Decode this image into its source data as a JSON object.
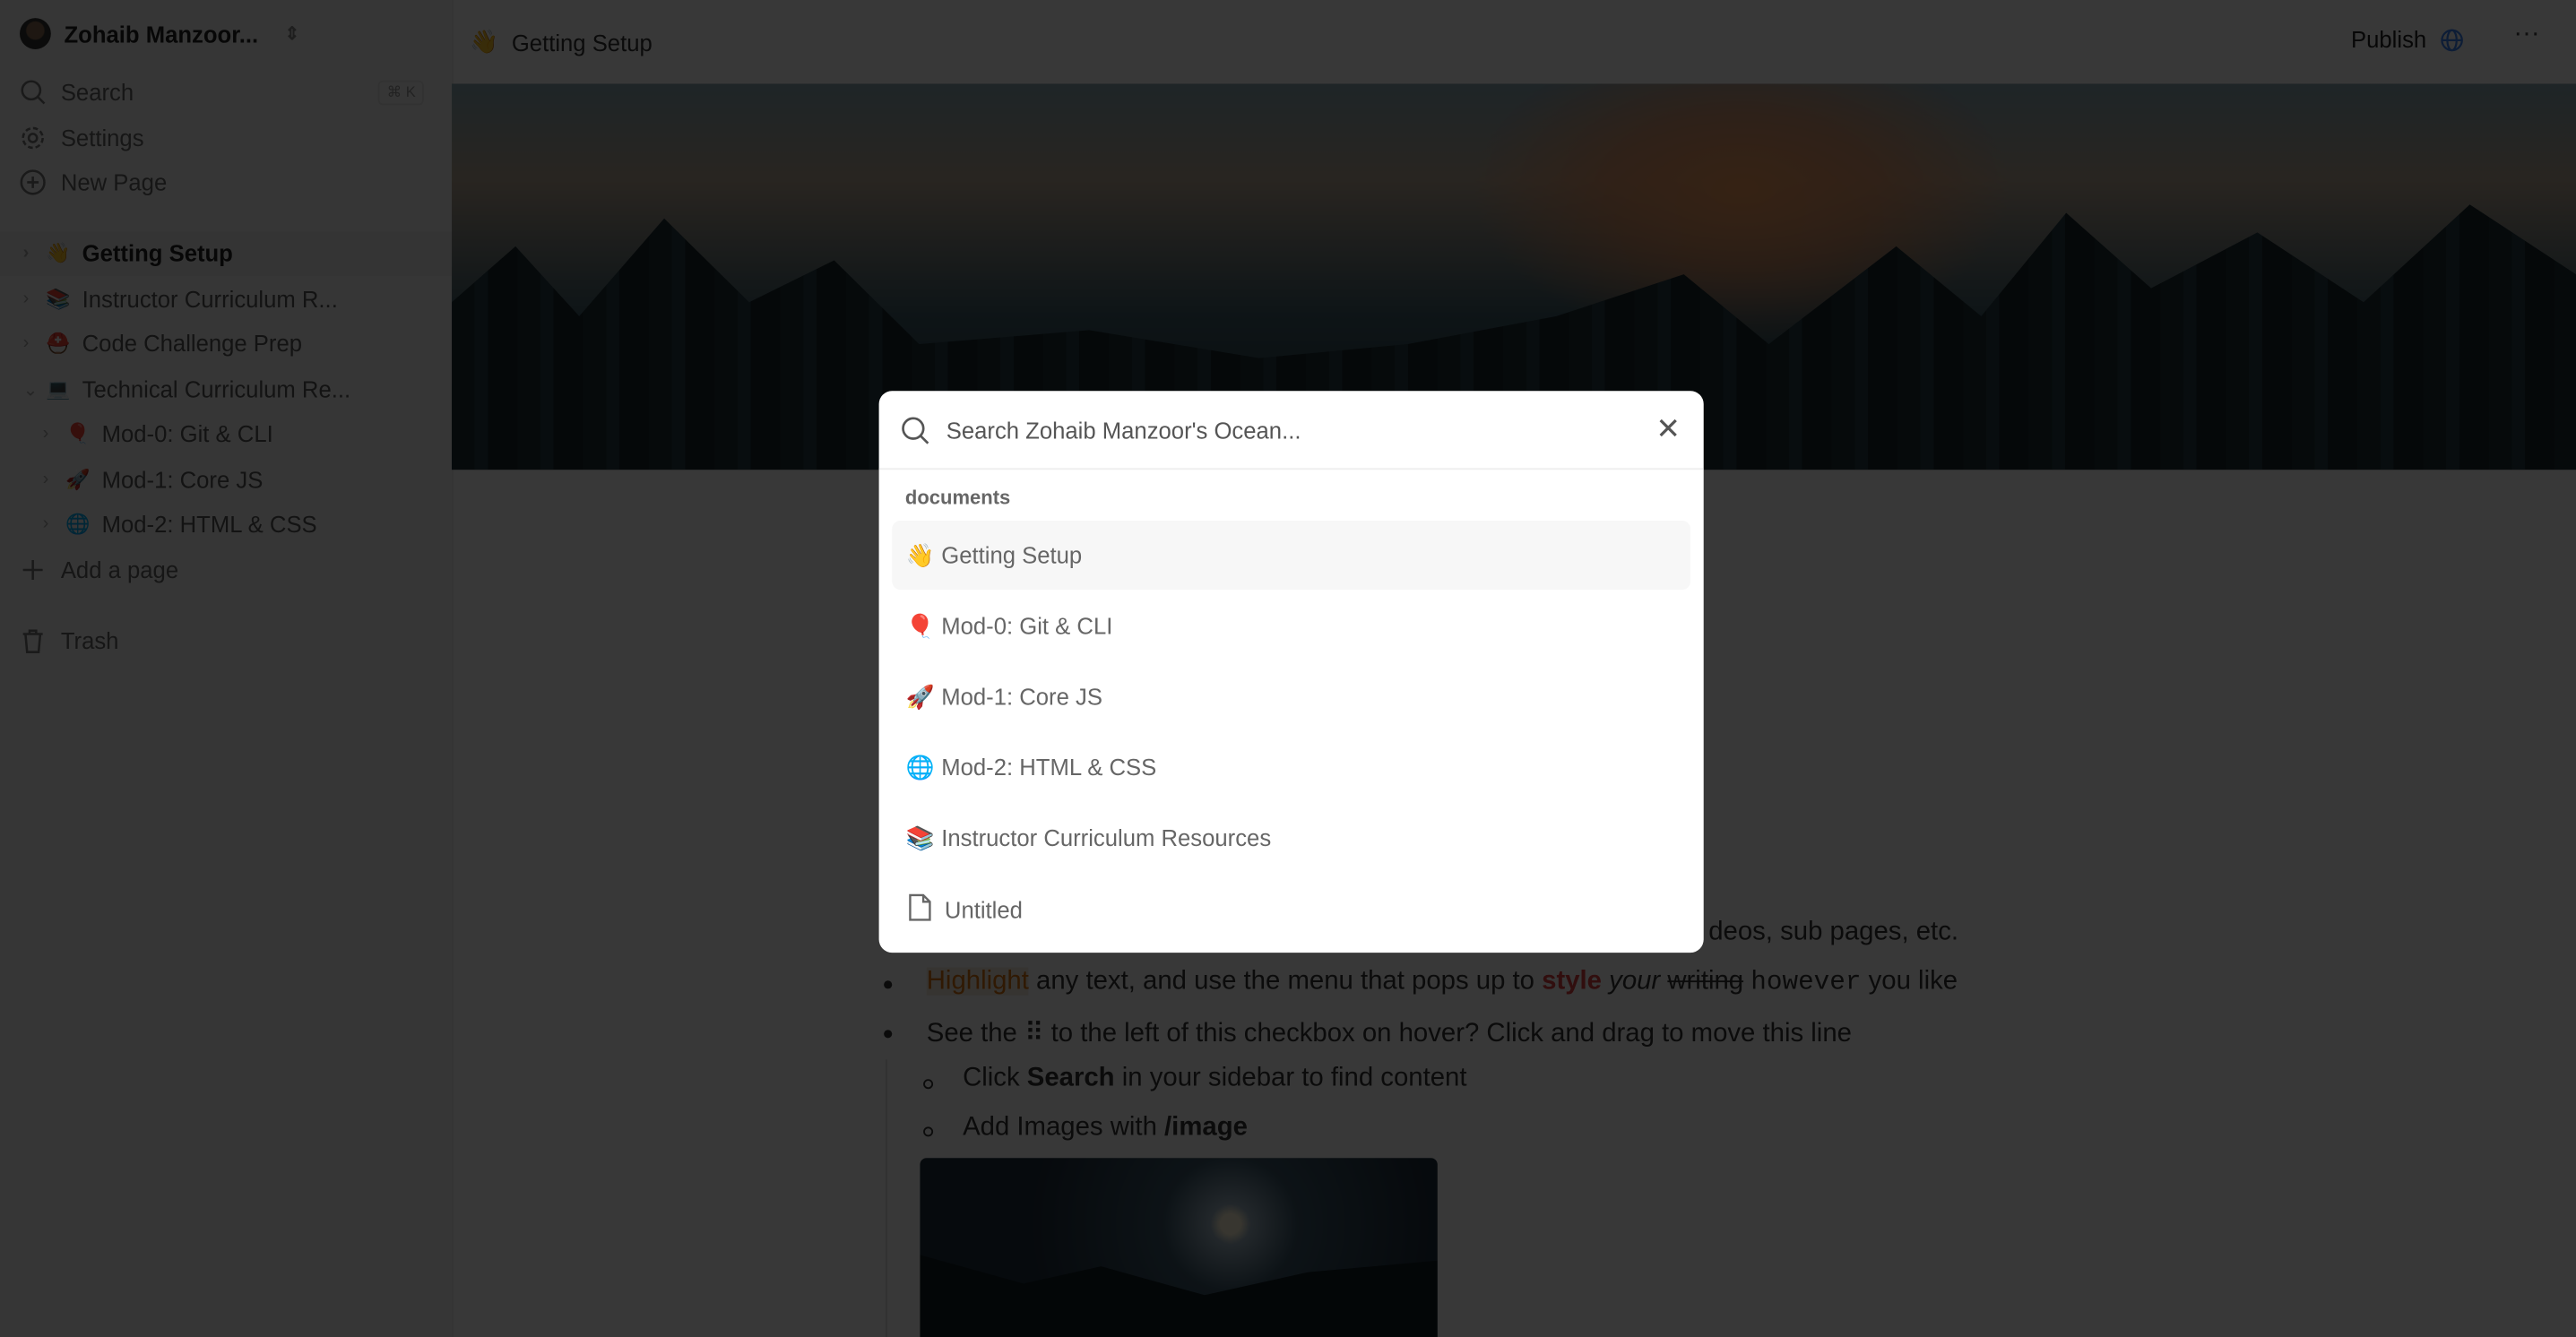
{
  "sidebar": {
    "workspace": "Zohaib Manzoor...",
    "search": "Search",
    "search_shortcut": "⌘ K",
    "settings": "Settings",
    "new_page": "New Page",
    "pages": [
      {
        "emoji": "👋",
        "label": "Getting Setup",
        "active": true
      },
      {
        "emoji": "📚",
        "label": "Instructor Curriculum R..."
      },
      {
        "emoji": "⛑️",
        "label": "Code Challenge Prep"
      },
      {
        "emoji": "💻",
        "label": "Technical Curriculum Re...",
        "expanded": true
      },
      {
        "emoji": "🎈",
        "label": "Mod-0: Git & CLI"
      },
      {
        "emoji": "🚀",
        "label": "Mod-1: Core JS"
      },
      {
        "emoji": "🌐",
        "label": "Mod-2: HTML & CSS"
      }
    ],
    "add_page": "Add a page",
    "trash": "Trash"
  },
  "header": {
    "emoji": "👋",
    "title": "Getting Setup",
    "publish": "Publish",
    "more": "···"
  },
  "content": {
    "line0_fragment": "deos, sub pages, etc.",
    "line1": {
      "highlight": "Highlight",
      "t1": " any text, and use the menu that pops up to ",
      "style": "style",
      "italic": "your",
      "strike": "writing",
      "mono": "however",
      "t2": " you like"
    },
    "line2": "See the ⠿ to the left of this checkbox on hover? Click and drag to move this line",
    "sub1": {
      "t1": "Click ",
      "bold": "Search",
      "t2": " in your sidebar to find content"
    },
    "sub2": {
      "t1": "Add Images with ",
      "bold": "/image"
    }
  },
  "search_modal": {
    "placeholder": "Search Zohaib Manzoor's Ocean...",
    "value": "",
    "section": "documents",
    "results": [
      {
        "emoji": "👋",
        "label": "Getting Setup"
      },
      {
        "emoji": "🎈",
        "label": "Mod-0: Git & CLI"
      },
      {
        "emoji": "🚀",
        "label": "Mod-1: Core JS"
      },
      {
        "emoji": "🌐",
        "label": "Mod-2: HTML & CSS"
      },
      {
        "emoji": "📚",
        "label": "Instructor Curriculum Resources"
      },
      {
        "emoji": "file-icon",
        "label": "Untitled"
      }
    ]
  }
}
